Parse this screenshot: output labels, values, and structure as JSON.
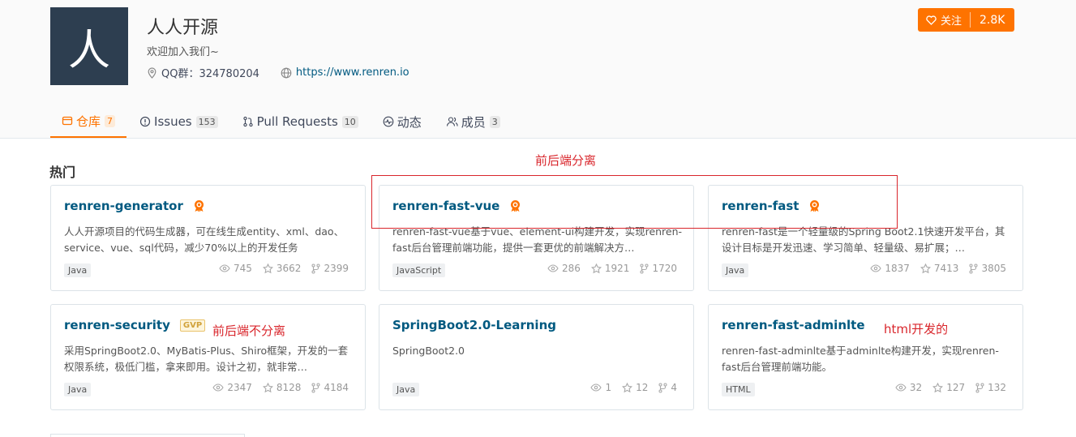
{
  "org": {
    "avatar_char": "人",
    "name": "人人开源",
    "description": "欢迎加入我们~",
    "qq": "QQ群：324780204",
    "website": "https://www.renren.io"
  },
  "follow": {
    "label": "关注",
    "count": "2.8K"
  },
  "tabs": [
    {
      "label": "仓库",
      "count": "7",
      "icon": "repo-icon"
    },
    {
      "label": "Issues",
      "count": "153",
      "icon": "issue-icon"
    },
    {
      "label": "Pull Requests",
      "count": "10",
      "icon": "pull-request-icon"
    },
    {
      "label": "动态",
      "count": "",
      "icon": "activity-icon"
    },
    {
      "label": "成员",
      "count": "3",
      "icon": "members-icon"
    }
  ],
  "section_title": "热门",
  "repos": [
    {
      "name": "renren-generator",
      "badge": "recommended",
      "desc": "人人开源项目的代码生成器，可在线生成entity、xml、dao、service、vue、sql代码，减少70%以上的开发任务",
      "lang": "Java",
      "views": "745",
      "stars": "3662",
      "forks": "2399"
    },
    {
      "name": "renren-fast-vue",
      "badge": "recommended",
      "desc": "renren-fast-vue基于vue、element-ui构建开发，实现renren-fast后台管理前端功能，提供一套更优的前端解决方…",
      "lang": "JavaScript",
      "views": "286",
      "stars": "1921",
      "forks": "1720"
    },
    {
      "name": "renren-fast",
      "badge": "recommended",
      "desc": "renren-fast是一个轻量级的Spring Boot2.1快速开发平台，其设计目标是开发迅速、学习简单、轻量级、易扩展；…",
      "lang": "Java",
      "views": "1837",
      "stars": "7413",
      "forks": "3805"
    },
    {
      "name": "renren-security",
      "badge": "GVP",
      "desc": "采用SpringBoot2.0、MyBatis-Plus、Shiro框架，开发的一套权限系统，极低门槛，拿来即用。设计之初，就非常…",
      "lang": "Java",
      "views": "2347",
      "stars": "8128",
      "forks": "4184"
    },
    {
      "name": "SpringBoot2.0-Learning",
      "badge": "",
      "desc": "SpringBoot2.0",
      "lang": "Java",
      "views": "1",
      "stars": "12",
      "forks": "4"
    },
    {
      "name": "renren-fast-adminlte",
      "badge": "",
      "desc": "renren-fast-adminlte基于adminlte构建开发，实现renren-fast后台管理前端功能。",
      "lang": "HTML",
      "views": "32",
      "stars": "127",
      "forks": "132"
    }
  ],
  "annotations": {
    "separated": "前后端分离",
    "not_separated": "前后端不分离",
    "html_dev": "html开发的"
  },
  "colors": {
    "accent": "#fe7300",
    "link": "#005980",
    "annotation": "#d9262c",
    "avatar_bg": "#2d3e50"
  }
}
